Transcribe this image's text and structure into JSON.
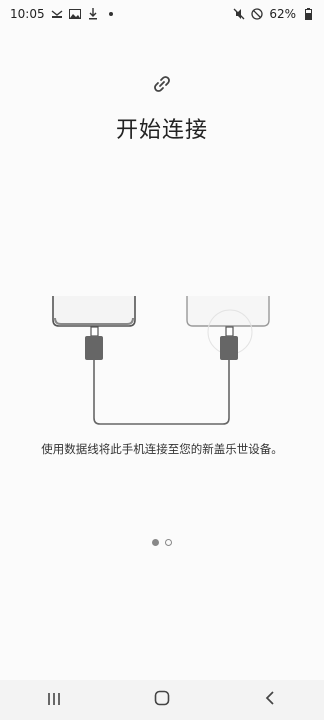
{
  "status": {
    "time": "10:05",
    "battery": "62%"
  },
  "main": {
    "title": "开始连接",
    "instruction": "使用数据线将此手机连接至您的新盖乐世设备。"
  },
  "pager": {
    "count": 2,
    "active": 0
  },
  "icons": {
    "header": "link-icon",
    "nav": [
      "recents-icon",
      "home-icon",
      "back-icon"
    ]
  }
}
